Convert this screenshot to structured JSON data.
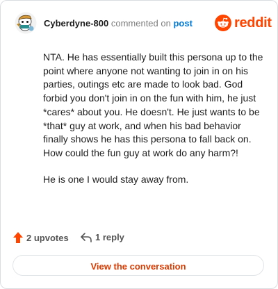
{
  "header": {
    "username": "Cyberdyne-800",
    "action_text": "commented on",
    "post_link": "post",
    "brand_name": "reddit"
  },
  "comment": {
    "paragraphs": [
      "NTA. He has essentially built this persona up to the point where anyone not wanting to join in on his parties, outings etc are made to look bad. God forbid you don't join in on the fun with him, he just *cares* about you. He doesn't. He just wants to be *that* guy at work, and when his bad behavior finally shows he has this persona to fall back on. How could the fun guy at work do any harm?!",
      "He is one I would stay away from."
    ]
  },
  "footer": {
    "upvotes": "2 upvotes",
    "replies": "1 reply"
  },
  "cta": {
    "label": "View the conversation"
  },
  "colors": {
    "brand": "#ff4500",
    "link": "#0079d3",
    "cta_text": "#d93a00"
  },
  "icons": {
    "avatar": "snoo-avatar-icon",
    "logo": "reddit-logo-icon",
    "upvote": "upvote-arrow-icon",
    "reply": "reply-arrow-icon"
  }
}
